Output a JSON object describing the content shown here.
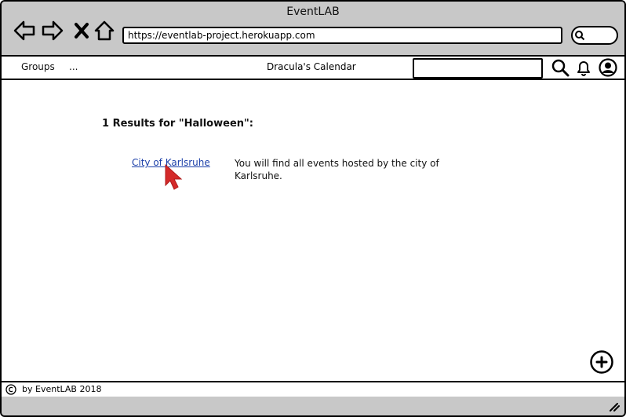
{
  "window": {
    "title": "EventLAB"
  },
  "browser": {
    "url": "https://eventlab-project.herokuapp.com"
  },
  "menubar": {
    "items": [
      {
        "label": "Groups"
      },
      {
        "label": "..."
      }
    ],
    "page_title": "Dracula's Calendar",
    "search_value": ""
  },
  "results": {
    "heading": "1 Results for \"Halloween\":",
    "items": [
      {
        "title": "City of Karlsruhe",
        "description": "You will find all events hosted by the city of Karlsruhe."
      }
    ]
  },
  "footer": {
    "text": "by EventLAB 2018"
  },
  "colors": {
    "link": "#1a3ea8",
    "cursor": "#d42a2a",
    "chrome": "#c8c8c8"
  }
}
